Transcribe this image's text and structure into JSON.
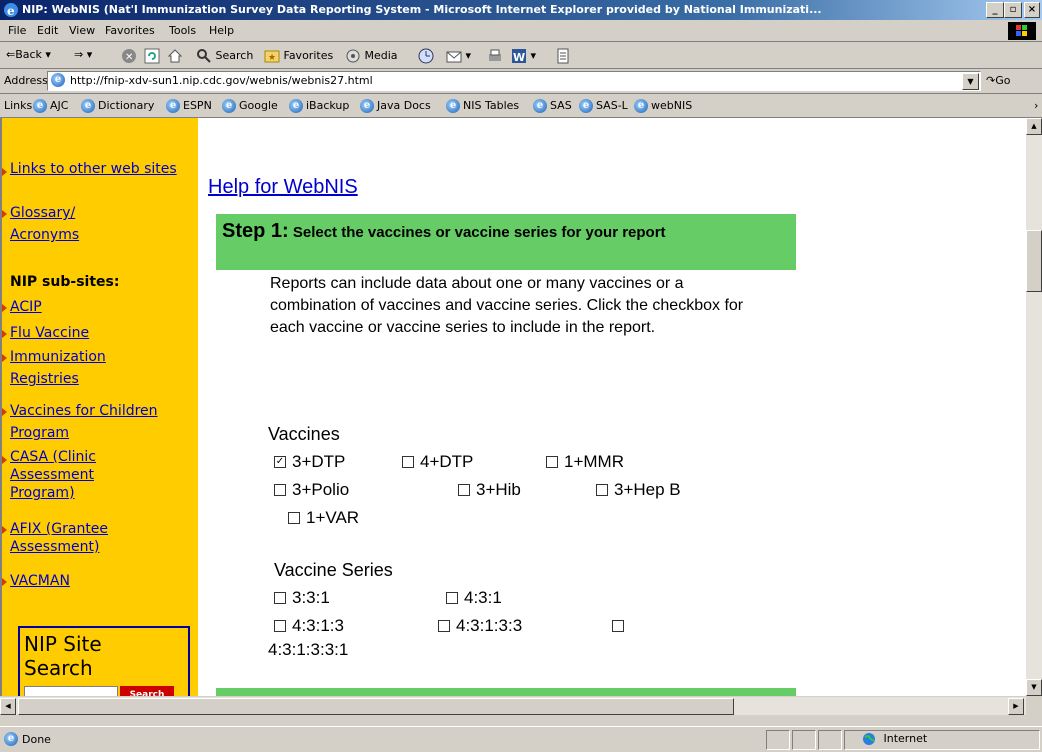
{
  "window": {
    "title": "NIP: WebNIS (Nat'l Immunization Survey Data Reporting System - Microsoft Internet Explorer provided by National Immunizati...",
    "min": "_",
    "max": "▫",
    "close": "×"
  },
  "menu": [
    "File",
    "Edit",
    "View",
    "Favorites",
    "Tools",
    "Help"
  ],
  "toolbar": {
    "back": "⇐Back",
    "forward": "⇒",
    "stop": "⊗",
    "search": "Search",
    "favorites": "Favorites",
    "media": "Media"
  },
  "address": {
    "label": "Address",
    "url": "http://fnip-xdv-sun1.nip.cdc.gov/webnis/webnis27.html",
    "go": "Go"
  },
  "links": {
    "label": "Links",
    "items": [
      "AJC",
      "Dictionary",
      "ESPN",
      "Google",
      "iBackup",
      "Java Docs",
      "NIS Tables",
      "SAS",
      "SAS-L",
      "webNIS"
    ]
  },
  "sidebar": {
    "links_top": [
      "Links to other web sites",
      "Glossary/ Acronyms"
    ],
    "subsites_heading": "NIP sub-sites:",
    "subsites": [
      "ACIP",
      "Flu Vaccine",
      "Immunization Registries",
      "Vaccines for Children Program",
      "CASA (Clinic Assessment Program)",
      "AFIX (Grantee Assessment)",
      "VACMAN"
    ],
    "search_title": "NIP Site Search",
    "search_button": "Search"
  },
  "main": {
    "help_link": "Help for WebNIS",
    "step1_label": "Step 1:",
    "step1_title": "Select the vaccines or vaccine series for your report",
    "description": "Reports can include data about one or many vaccines or a combination of vaccines and vaccine series. Click the checkbox for each vaccine or vaccine series to include in the report.",
    "vaccines_heading": "Vaccines",
    "vaccines": [
      {
        "label": "3+DTP",
        "checked": true
      },
      {
        "label": "4+DTP",
        "checked": false
      },
      {
        "label": "1+MMR",
        "checked": false
      },
      {
        "label": "3+Polio",
        "checked": false
      },
      {
        "label": "3+Hib",
        "checked": false
      },
      {
        "label": "3+Hep B",
        "checked": false
      },
      {
        "label": "1+VAR",
        "checked": false
      }
    ],
    "series_heading": "Vaccine Series",
    "series": [
      {
        "label": "3:3:1",
        "checked": false
      },
      {
        "label": "4:3:1",
        "checked": false
      },
      {
        "label": "4:3:1:3",
        "checked": false
      },
      {
        "label": "4:3:1:3:3",
        "checked": false
      },
      {
        "label": "4:3:1:3:3:1",
        "checked": false
      }
    ]
  },
  "status": {
    "text": "Done",
    "zone": "Internet"
  }
}
